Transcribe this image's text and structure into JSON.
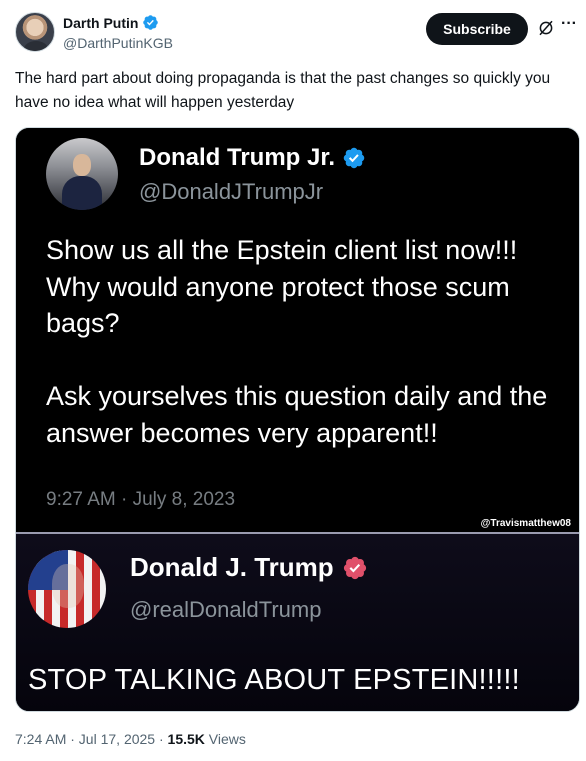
{
  "post": {
    "author_name": "Darth Putin",
    "author_handle": "@DarthPutinKGB",
    "subscribe_label": "Subscribe",
    "more_label": "···",
    "text": "The hard part about doing propaganda is that the past changes so quickly you have no idea what will happen yesterday",
    "time": "7:24 AM · Jul 17, 2025 · ",
    "views_count": "15.5K",
    "views_label": " Views"
  },
  "media": {
    "upper": {
      "name": "Donald Trump Jr.",
      "handle": "@DonaldJTrumpJr",
      "text": "Show us all the Epstein client list now!!! Why would anyone protect those scum bags?\n\nAsk yourselves this question daily and the answer becomes very apparent!!",
      "time": "9:27 AM · July 8, 2023",
      "watermark": "@Travismatthew08"
    },
    "lower": {
      "name": "Donald J. Trump",
      "handle": "@realDonaldTrump",
      "text": "STOP TALKING ABOUT EPSTEIN!!!!!"
    }
  },
  "colors": {
    "verified_blue": "#1d9bf0",
    "verified_pink": "#e0506a",
    "subscribe_bg": "#0f1419",
    "secondary_text": "#536471"
  },
  "icons": [
    "verified-badge-icon",
    "grok-icon",
    "more-icon"
  ]
}
